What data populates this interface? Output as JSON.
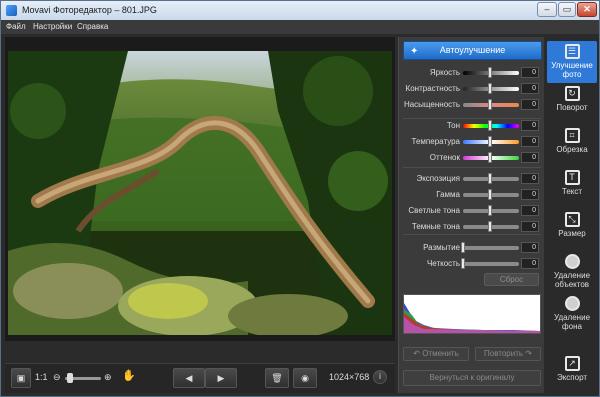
{
  "window": {
    "title": "Movavi Фоторедактор – 801.JPG"
  },
  "window_controls": {
    "minimize": "–",
    "maximize": "▭",
    "close": "✕"
  },
  "menu": {
    "file": "Файл",
    "settings": "Настройки",
    "help": "Справка"
  },
  "panel": {
    "auto_button": "Автоулучшение",
    "sliders": [
      {
        "label": "Яркость",
        "value": "0",
        "level": 0.5
      },
      {
        "label": "Контрастность",
        "value": "0",
        "level": 0.5
      },
      {
        "label": "Насыщенность",
        "value": "0",
        "level": 0.5
      },
      {
        "label": "Тон",
        "value": "0",
        "level": 0.5
      },
      {
        "label": "Температура",
        "value": "0",
        "level": 0.5
      },
      {
        "label": "Оттенок",
        "value": "0",
        "level": 0.5
      },
      {
        "label": "Экспозиция",
        "value": "0",
        "level": 0.5
      },
      {
        "label": "Гамма",
        "value": "0",
        "level": 0.5
      },
      {
        "label": "Светлые тона",
        "value": "0",
        "level": 0.5
      },
      {
        "label": "Темные тона",
        "value": "0",
        "level": 0.5
      },
      {
        "label": "Размытие",
        "value": "0",
        "level": 0.0
      },
      {
        "label": "Четкость",
        "value": "0",
        "level": 0.0
      }
    ],
    "reset": "Сброс",
    "undo": "Отменить",
    "redo": "Повторить",
    "revert": "Вернуться к оригиналу"
  },
  "tools": [
    {
      "label": "Улучшение фото",
      "icon": "sliders-icon",
      "active": true
    },
    {
      "label": "Поворот",
      "icon": "rotate-icon",
      "active": false
    },
    {
      "label": "Обрезка",
      "icon": "crop-icon",
      "active": false
    },
    {
      "label": "Текст",
      "icon": "text-icon",
      "active": false
    },
    {
      "label": "Размер",
      "icon": "resize-icon",
      "active": false
    },
    {
      "label": "Удаление объектов",
      "icon": "object-removal-icon",
      "active": false
    },
    {
      "label": "Удаление фона",
      "icon": "background-removal-icon",
      "active": false
    }
  ],
  "export": {
    "label": "Экспорт"
  },
  "bottom": {
    "zoom_ratio": "1:1",
    "dimensions": "1024×768",
    "info": "i"
  }
}
